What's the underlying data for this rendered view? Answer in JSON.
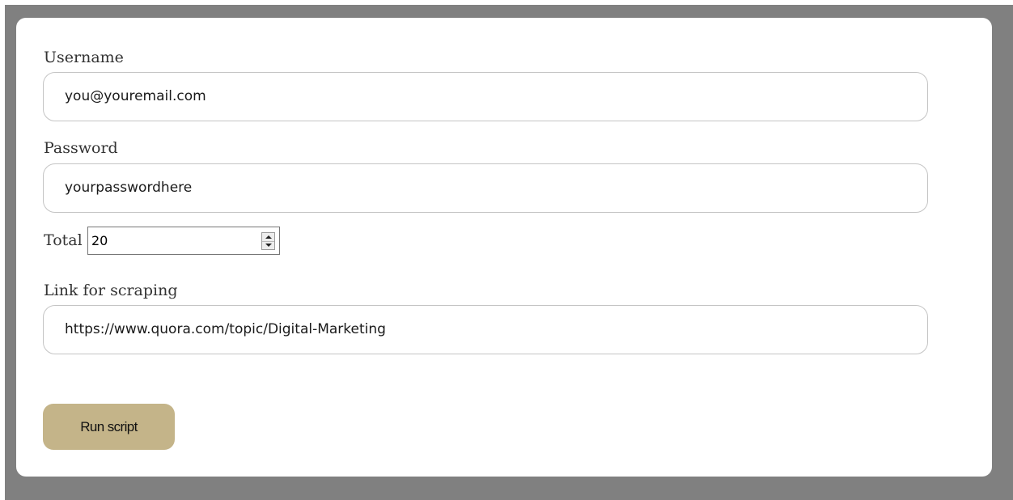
{
  "form": {
    "username_label": "Username",
    "username_value": "you@youremail.com",
    "password_label": "Password",
    "password_value": "yourpasswordhere",
    "total_label": "Total",
    "total_value": "20",
    "link_label": "Link for scraping",
    "link_value": "https://www.quora.com/topic/Digital-Marketing",
    "run_button_label": "Run script"
  },
  "colors": {
    "page_background": "#808080",
    "card_background": "#ffffff",
    "button_background": "#c4b489",
    "input_border": "#c4c4c4"
  },
  "icons": {
    "spinner_up": "spinner-up-icon",
    "spinner_down": "spinner-down-icon"
  }
}
